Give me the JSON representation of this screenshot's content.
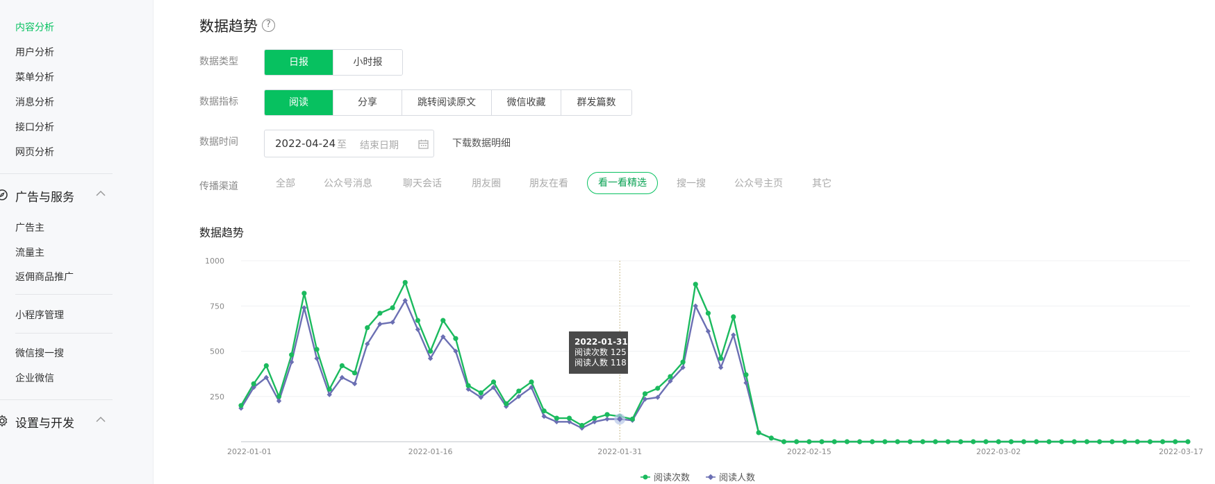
{
  "sidebar": {
    "group1": [
      "内容分析",
      "用户分析",
      "菜单分析",
      "消息分析",
      "接口分析",
      "网页分析"
    ],
    "active_index": 0,
    "section_ads": "广告与服务",
    "group2": [
      "广告主",
      "流量主",
      "返佣商品推广"
    ],
    "mini_program": "小程序管理",
    "group3": [
      "微信搜一搜",
      "企业微信"
    ],
    "section_settings": "设置与开发"
  },
  "main": {
    "title": "数据趋势",
    "help_icon": "question-circle-icon",
    "data_type": {
      "label": "数据类型",
      "options": [
        "日报",
        "小时报"
      ],
      "selected": 0
    },
    "data_metric": {
      "label": "数据指标",
      "options": [
        "阅读",
        "分享",
        "跳转阅读原文",
        "微信收藏",
        "群发篇数"
      ],
      "selected": 0
    },
    "data_time": {
      "label": "数据时间",
      "start": "2022-04-24",
      "separator": "至",
      "end_placeholder": "结束日期",
      "download": "下载数据明细"
    },
    "channels": {
      "label": "传播渠道",
      "options": [
        "全部",
        "公众号消息",
        "聊天会话",
        "朋友圈",
        "朋友在看",
        "看一看精选",
        "搜一搜",
        "公众号主页",
        "其它"
      ],
      "selected": 5
    },
    "chart_title": "数据趋势"
  },
  "colors": {
    "accent": "#07c160",
    "series_read_count": "#1bba5e",
    "series_readers": "#6b6fb3"
  },
  "chart_data": {
    "type": "line",
    "x_start": "2022-01-01",
    "x_end": "2022-03-17",
    "x_tick_labels": [
      "2022-01-01",
      "2022-01-16",
      "2022-01-31",
      "2022-02-15",
      "2022-03-02",
      "2022-03-17"
    ],
    "y_ticks": [
      250,
      500,
      750,
      1000
    ],
    "ylim": [
      0,
      1000
    ],
    "series": [
      {
        "name": "阅读次数",
        "values": [
          200,
          320,
          420,
          250,
          480,
          820,
          510,
          290,
          420,
          380,
          630,
          710,
          740,
          880,
          670,
          500,
          670,
          570,
          310,
          270,
          330,
          210,
          280,
          330,
          170,
          130,
          130,
          90,
          130,
          150,
          140,
          125,
          265,
          295,
          360,
          440,
          870,
          710,
          460,
          690,
          370,
          50,
          20,
          0,
          0,
          0,
          0,
          0,
          0,
          0,
          0,
          0,
          0,
          0,
          0,
          0,
          0,
          0,
          0,
          0,
          0,
          0,
          0,
          0,
          0,
          0,
          0,
          0,
          0,
          0,
          0,
          0,
          0,
          0,
          0,
          0
        ]
      },
      {
        "name": "阅读人数",
        "values": [
          185,
          300,
          355,
          225,
          440,
          740,
          460,
          260,
          355,
          320,
          540,
          650,
          660,
          780,
          620,
          460,
          580,
          500,
          290,
          245,
          300,
          195,
          250,
          300,
          140,
          110,
          110,
          75,
          110,
          125,
          125,
          118,
          235,
          245,
          335,
          410,
          750,
          610,
          410,
          590,
          325,
          50,
          20,
          0,
          0,
          0,
          0,
          0,
          0,
          0,
          0,
          0,
          0,
          0,
          0,
          0,
          0,
          0,
          0,
          0,
          0,
          0,
          0,
          0,
          0,
          0,
          0,
          0,
          0,
          0,
          0,
          0,
          0,
          0,
          0,
          0
        ]
      }
    ],
    "tooltip": {
      "date": "2022-01-31",
      "lines": [
        "阅读次数 125",
        "阅读人数 118"
      ]
    },
    "legend_position": "bottom-center",
    "grid": true
  }
}
